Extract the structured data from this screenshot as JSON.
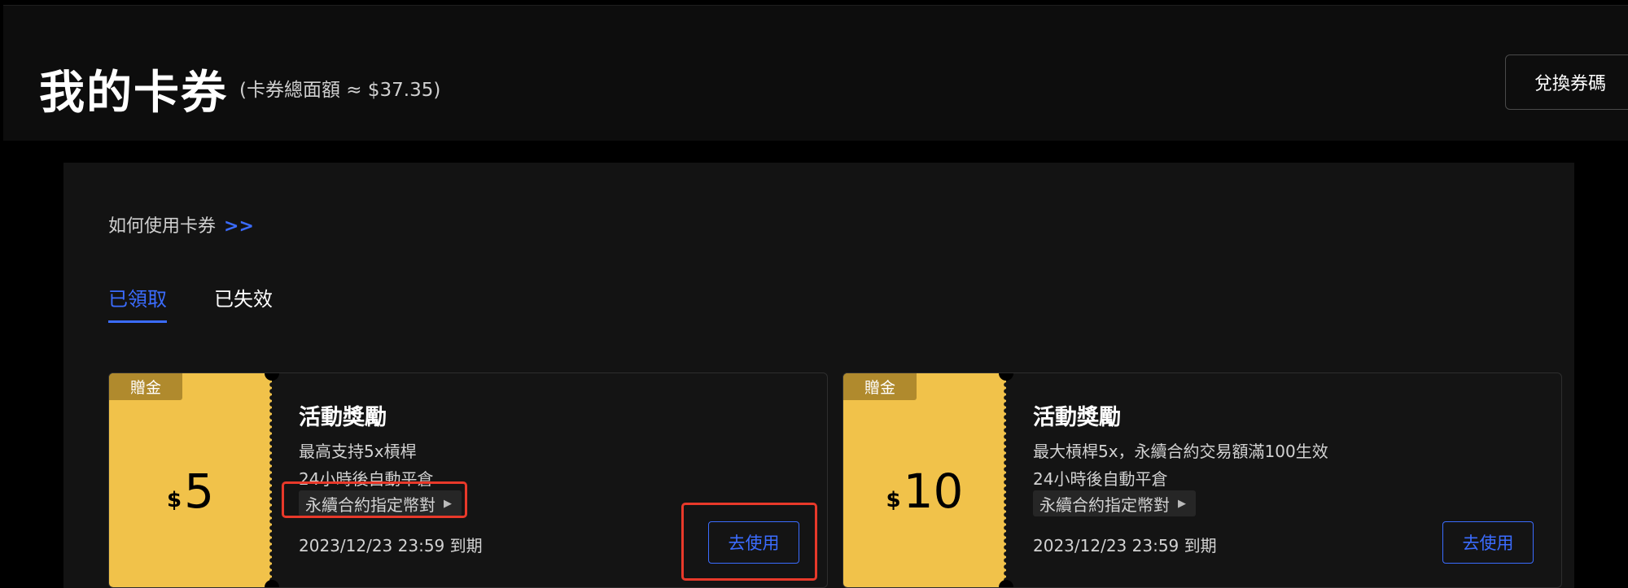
{
  "header": {
    "title": "我的卡券",
    "total": "(卡券總面額 ≈ $37.35)",
    "redeem_button": "兌換券碼"
  },
  "howto": {
    "text": "如何使用卡券",
    "arrows": ">>"
  },
  "tabs": [
    {
      "label": "已領取",
      "active": true
    },
    {
      "label": "已失效",
      "active": false
    }
  ],
  "coupons": [
    {
      "badge": "贈金",
      "currency": "$",
      "amount": "5",
      "title": "活動獎勵",
      "line1": "最高支持5x槓桿",
      "line2": "24小時後自動平倉",
      "chip": "永續合約指定幣對",
      "expire": "2023/12/23 23:59 到期",
      "button": "去使用"
    },
    {
      "badge": "贈金",
      "currency": "$",
      "amount": "10",
      "title": "活動獎勵",
      "line1": "最大槓桿5x，永續合約交易額滿100生效",
      "line2": "24小時後自動平倉",
      "chip": "永續合約指定幣對",
      "expire": "2023/12/23 23:59 到期",
      "button": "去使用"
    }
  ],
  "colors": {
    "accent": "#3b6cff",
    "stub": "#f1c24a",
    "badge": "#b08a2d",
    "highlight": "#e8392a"
  }
}
